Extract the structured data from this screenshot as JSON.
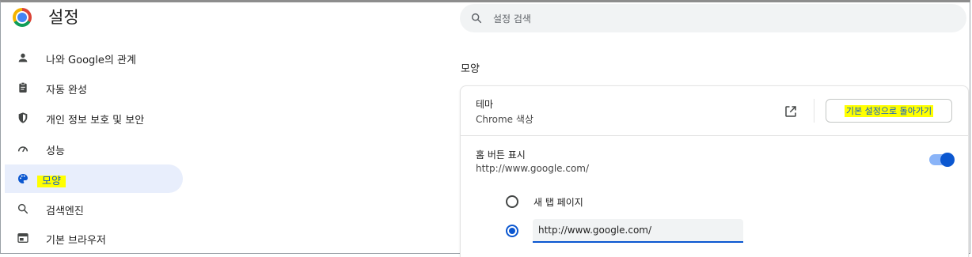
{
  "header": {
    "title": "설정",
    "logo_icon": "chrome-logo-icon",
    "search": {
      "placeholder": "설정 검색",
      "icon": "search-icon"
    }
  },
  "sidebar": {
    "items": [
      {
        "label": "나와 Google의 관계",
        "icon": "person-icon",
        "active": false
      },
      {
        "label": "자동 완성",
        "icon": "clipboard-icon",
        "active": false
      },
      {
        "label": "개인 정보 보호 및 보안",
        "icon": "shield-icon",
        "active": false
      },
      {
        "label": "성능",
        "icon": "speedometer-icon",
        "active": false
      },
      {
        "label": "모양",
        "icon": "palette-icon",
        "active": true
      },
      {
        "label": "검색엔진",
        "icon": "search-icon",
        "active": false
      },
      {
        "label": "기본 브라우저",
        "icon": "browser-window-icon",
        "active": false
      }
    ]
  },
  "main": {
    "section_title": "모양",
    "theme": {
      "title": "테마",
      "subtitle": "Chrome 색상",
      "open_icon": "open-in-new-icon",
      "reset_button": "기본 설정으로 돌아가기"
    },
    "home_button": {
      "title": "홈 버튼 표시",
      "subtitle": "http://www.google.com/",
      "enabled": true,
      "options": [
        {
          "label": "새 탭 페이지",
          "selected": false
        },
        {
          "value": "http://www.google.com/",
          "selected": true
        }
      ]
    }
  },
  "colors": {
    "accent": "#0b57d0",
    "active_nav_bg": "#e8eefc",
    "highlight": "#ffff00",
    "toggle_track": "#8ab4f8"
  }
}
